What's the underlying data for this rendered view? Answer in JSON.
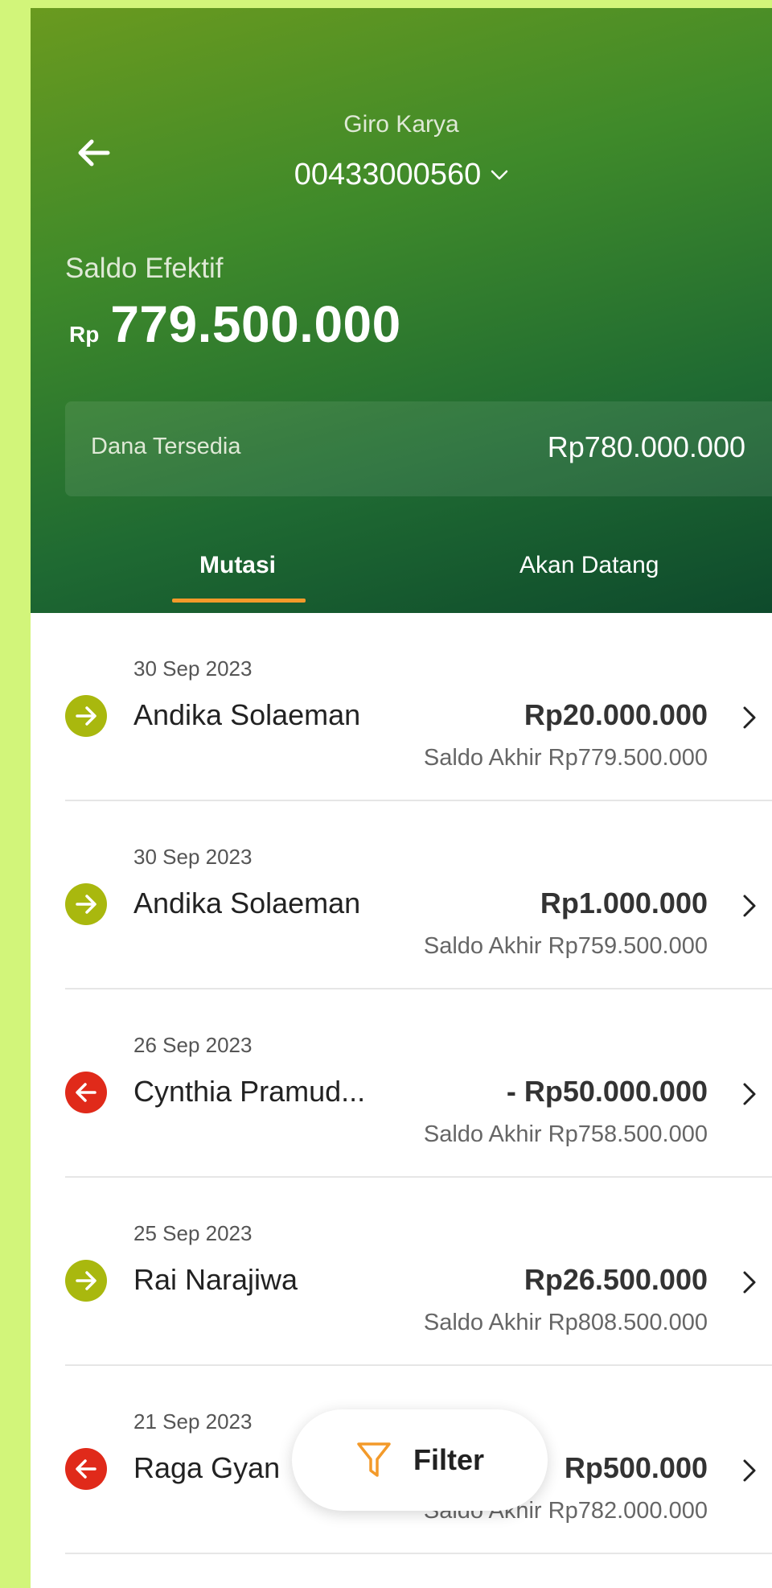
{
  "header": {
    "account_name": "Giro Karya",
    "account_number": "00433000560",
    "saldo_label": "Saldo Efektif",
    "saldo_currency": "Rp",
    "saldo_value": "779.500.000",
    "dana_label": "Dana Tersedia",
    "dana_value": "Rp780.000.000"
  },
  "tabs": [
    {
      "label": "Mutasi",
      "active": true
    },
    {
      "label": "Akan Datang",
      "active": false
    }
  ],
  "transactions": [
    {
      "date": "30 Sep 2023",
      "name": "Andika Solaeman",
      "amount": "Rp20.000.000",
      "saldo": "Saldo Akhir Rp779.500.000",
      "direction": "in"
    },
    {
      "date": "30 Sep 2023",
      "name": "Andika Solaeman",
      "amount": "Rp1.000.000",
      "saldo": "Saldo Akhir Rp759.500.000",
      "direction": "in"
    },
    {
      "date": "26 Sep 2023",
      "name": "Cynthia Pramud...",
      "amount": "- Rp50.000.000",
      "saldo": "Saldo Akhir Rp758.500.000",
      "direction": "out"
    },
    {
      "date": "25 Sep 2023",
      "name": "Rai Narajiwa",
      "amount": "Rp26.500.000",
      "saldo": "Saldo Akhir Rp808.500.000",
      "direction": "in"
    },
    {
      "date": "21 Sep 2023",
      "name": "Raga Gyan",
      "amount": "Rp500.000",
      "saldo": "Saldo Akhir Rp782.000.000",
      "direction": "out"
    }
  ],
  "filter": {
    "label": "Filter"
  },
  "colors": {
    "incoming_icon": "#a9b80e",
    "outgoing_icon": "#e02a1a",
    "tab_underline": "#f39a2a",
    "filter_icon": "#f39a2a"
  },
  "icons": {
    "back": "arrow-left-icon",
    "account_dropdown": "chevron-down-icon",
    "incoming": "arrow-right-icon",
    "outgoing": "arrow-left-icon",
    "row_chevron": "chevron-right-icon",
    "filter": "filter-funnel-icon"
  }
}
